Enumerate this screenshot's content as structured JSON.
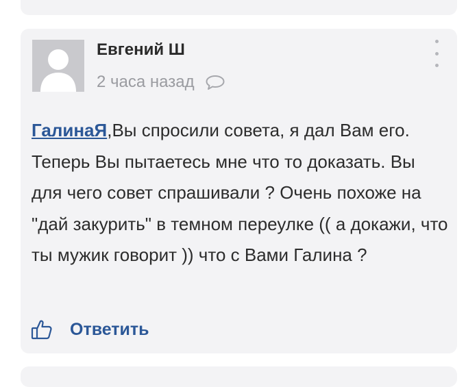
{
  "comment": {
    "author": "Евгений Ш",
    "time": "2 часа назад",
    "mention": "ГалинаЯ",
    "text": ",Вы спросили совета, я дал Вам его. Теперь Вы пытаетесь мне что то доказать. Вы для чего совет спрашивали ? Очень похоже на \"дай закурить\" в темном переулке (( а докажи, что ты мужик говорит )) что с Вами Галина ?",
    "reply_label": "Ответить"
  },
  "icons": {
    "avatar": "user-placeholder-icon",
    "reply_bubble": "speech-bubble-icon",
    "menu": "kebab-menu-icon",
    "like": "thumbs-up-icon"
  },
  "colors": {
    "card_bg": "#f3f3f5",
    "link": "#2b5797",
    "muted": "#9a9ba0",
    "text": "#2c2c2c"
  }
}
